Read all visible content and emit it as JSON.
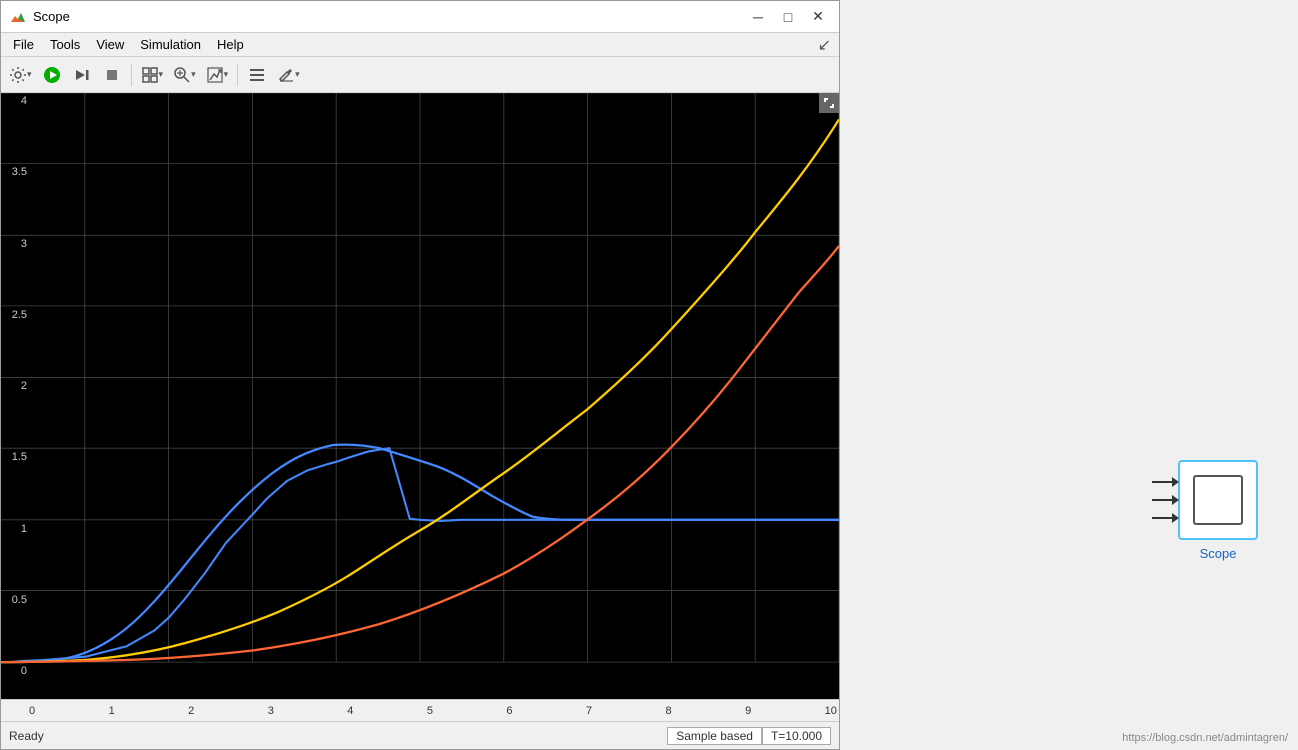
{
  "window": {
    "title": "Scope",
    "icon_color": "#e04000"
  },
  "titlebar": {
    "minimize_label": "─",
    "maximize_label": "□",
    "close_label": "✕"
  },
  "menubar": {
    "items": [
      {
        "label": "File"
      },
      {
        "label": "Tools"
      },
      {
        "label": "View"
      },
      {
        "label": "Simulation"
      },
      {
        "label": "Help"
      }
    ],
    "corner": "↙"
  },
  "toolbar": {
    "buttons": [
      {
        "name": "settings",
        "icon": "⚙",
        "dropdown": true
      },
      {
        "name": "run",
        "icon": "▶",
        "color": "#00b000"
      },
      {
        "name": "step-forward",
        "icon": "⏭"
      },
      {
        "name": "stop",
        "icon": "⏹"
      },
      {
        "name": "layout",
        "icon": "⊞",
        "dropdown": true
      },
      {
        "name": "zoom",
        "icon": "🔍",
        "dropdown": true
      },
      {
        "name": "autoscale",
        "icon": "⤢",
        "dropdown": true
      },
      {
        "name": "legend",
        "icon": "≡"
      },
      {
        "name": "edit",
        "icon": "✎",
        "dropdown": true
      }
    ]
  },
  "plot": {
    "background": "#000000",
    "grid_color": "#444444",
    "y_min": 0,
    "y_max": 4,
    "x_min": 0,
    "x_max": 10,
    "y_labels": [
      "0",
      "0.5",
      "1",
      "1.5",
      "2",
      "2.5",
      "3",
      "3.5",
      "4"
    ],
    "x_labels": [
      "0",
      "1",
      "2",
      "3",
      "4",
      "5",
      "6",
      "7",
      "8",
      "9",
      "10"
    ],
    "traces": [
      {
        "color": "#4488ff",
        "name": "blue-trace"
      },
      {
        "color": "#ffcc00",
        "name": "yellow-trace"
      },
      {
        "color": "#ff6633",
        "name": "red-trace"
      }
    ]
  },
  "statusbar": {
    "ready_label": "Ready",
    "sample_based_label": "Sample based",
    "time_label": "T=10.000"
  },
  "scope_block": {
    "label": "Scope"
  },
  "watermark": {
    "text": "https://blog.csdn.net/admintagren/"
  }
}
